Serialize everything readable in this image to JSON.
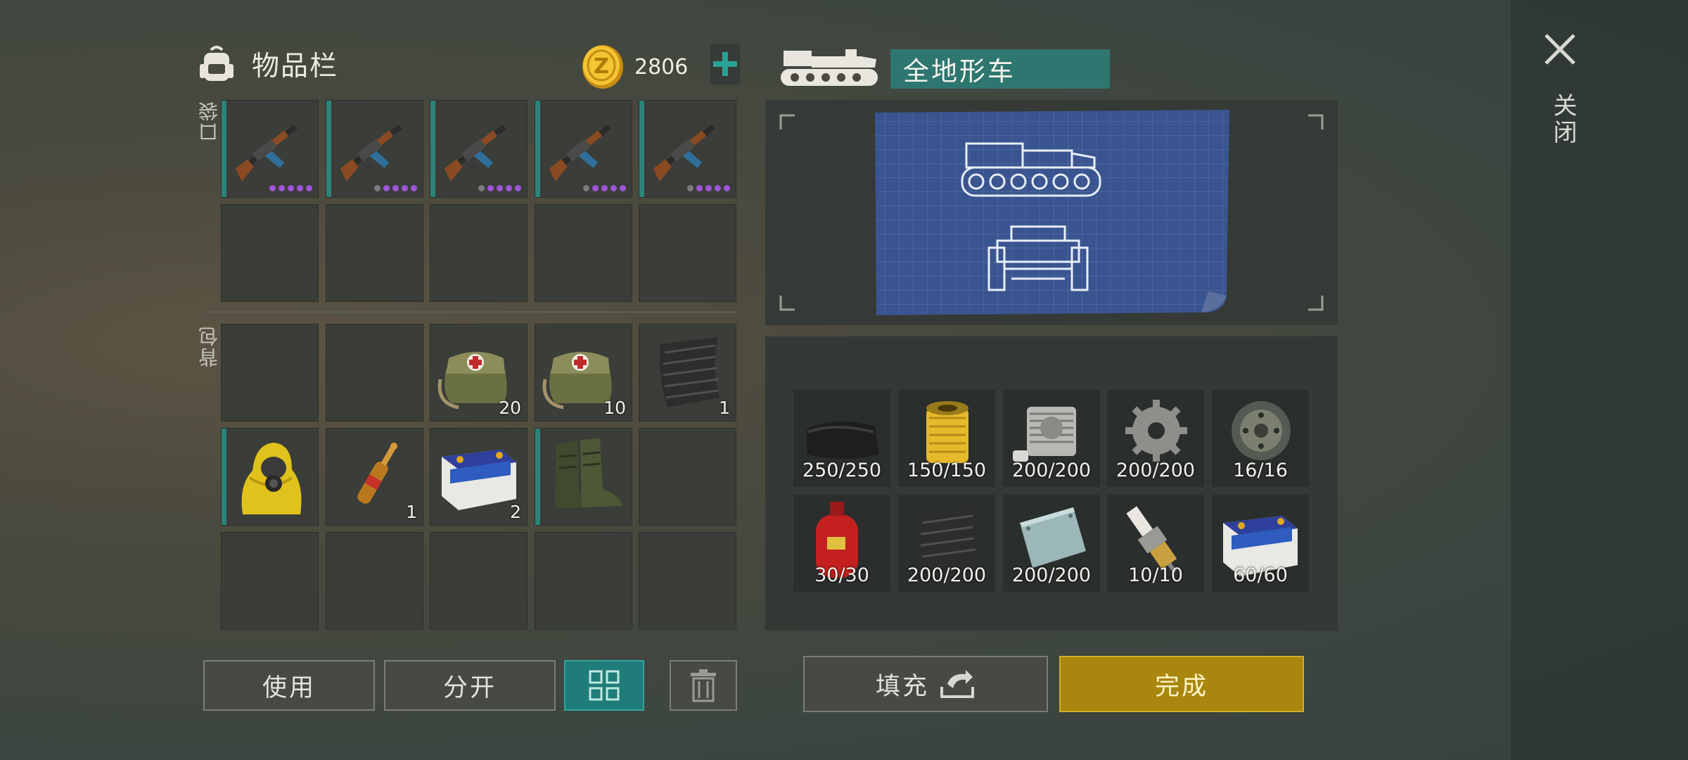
{
  "inventory": {
    "title": "物品栏",
    "coins": "2806",
    "pocket_label": "口袋",
    "backpack_label": "背包",
    "pocket_items": [
      {
        "name": "ak-rifle",
        "dots": "purple"
      },
      {
        "name": "ak-rifle",
        "dots": "mixed"
      },
      {
        "name": "ak-rifle",
        "dots": "mixed"
      },
      {
        "name": "ak-rifle",
        "dots": "mixed"
      },
      {
        "name": "ak-rifle",
        "dots": "mixed"
      }
    ],
    "backpack_counts": {
      "medkit_1": "20",
      "medkit_2": "10",
      "carbon_fabric": "1",
      "ampoule": "1",
      "battery": "2"
    }
  },
  "buttons": {
    "use": "使用",
    "split": "分开",
    "fill": "填充",
    "done": "完成"
  },
  "vehicle": {
    "name": "全地形车"
  },
  "materials": [
    {
      "icon": "leather-icon",
      "count": "250/250"
    },
    {
      "icon": "air-filter-icon",
      "count": "150/150"
    },
    {
      "icon": "engine-cylinder-icon",
      "count": "200/200"
    },
    {
      "icon": "gear-icon",
      "count": "200/200"
    },
    {
      "icon": "wheel-icon",
      "count": "16/16"
    },
    {
      "icon": "gas-cylinder-icon",
      "count": "30/30"
    },
    {
      "icon": "carbon-fabric-icon",
      "count": "200/200"
    },
    {
      "icon": "metal-plate-icon",
      "count": "200/200"
    },
    {
      "icon": "spark-plug-icon",
      "count": "10/10"
    },
    {
      "icon": "battery-icon",
      "count": "60/60"
    }
  ],
  "close_label": "关闭",
  "colors": {
    "accent": "#2c8479",
    "gold": "#a9870e",
    "rarity": "#9e55d8"
  }
}
